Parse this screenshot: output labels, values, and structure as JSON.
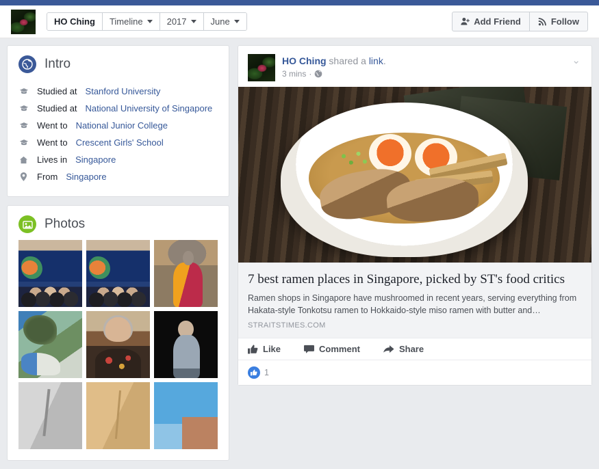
{
  "nav": {
    "profile_name": "HO Ching",
    "tabs": [
      {
        "label": "Timeline",
        "has_caret": true
      },
      {
        "label": "2017",
        "has_caret": true
      },
      {
        "label": "June",
        "has_caret": true
      }
    ],
    "add_friend_label": "Add Friend",
    "follow_label": "Follow",
    "avatar_icon": "profile-photo-thumbnail"
  },
  "intro": {
    "title": "Intro",
    "icon": "globe-icon",
    "rows": [
      {
        "icon": "graduation-cap-icon",
        "prefix": "Studied at",
        "link": "Stanford University"
      },
      {
        "icon": "graduation-cap-icon",
        "prefix": "Studied at",
        "link": "National University of Singapore"
      },
      {
        "icon": "graduation-cap-icon",
        "prefix": "Went to",
        "link": "National Junior College"
      },
      {
        "icon": "graduation-cap-icon",
        "prefix": "Went to",
        "link": "Crescent Girls' School"
      },
      {
        "icon": "home-icon",
        "prefix": "Lives in",
        "link": "Singapore"
      },
      {
        "icon": "map-pin-icon",
        "prefix": "From",
        "link": "Singapore"
      }
    ]
  },
  "photos": {
    "title": "Photos",
    "icon": "photo-icon",
    "items": [
      {
        "name": "photo-group-mural-1",
        "style": "ph-mural"
      },
      {
        "name": "photo-group-mural-2",
        "style": "ph-mural"
      },
      {
        "name": "photo-portrait-orange-jacket",
        "style": "ph-orange"
      },
      {
        "name": "photo-water-rocks",
        "style": "ph-water"
      },
      {
        "name": "photo-portrait-floral",
        "style": "ph-portrait"
      },
      {
        "name": "photo-woman-dark-background",
        "style": "ph-dark"
      },
      {
        "name": "photo-gray-texture",
        "style": "ph-gray"
      },
      {
        "name": "photo-sand-texture",
        "style": "ph-sand"
      },
      {
        "name": "photo-building-sky",
        "style": "ph-sky"
      }
    ]
  },
  "post": {
    "author": "HO Ching",
    "action_text": " shared a ",
    "link_word": "link",
    "trailing": ".",
    "timestamp": "3 mins",
    "separator": "·",
    "privacy_icon": "globe-icon",
    "menu_icon": "chevron-down-icon",
    "photo_icon": "ramen-bowl-photo",
    "link": {
      "title": "7 best ramen places in Singapore, picked by ST's food critics",
      "description": "Ramen shops in Singapore have mushroomed in recent years, serving everything from Hakata-style Tonkotsu ramen to Hokkaido-style miso ramen with butter and…",
      "domain": "STRAITSTIMES.COM"
    },
    "actions": [
      {
        "label": "Like",
        "icon": "thumbs-up-icon"
      },
      {
        "label": "Comment",
        "icon": "comment-icon"
      },
      {
        "label": "Share",
        "icon": "share-arrow-icon"
      }
    ],
    "like_count": "1",
    "like_badge_icon": "thumbs-up-badge-icon"
  },
  "colors": {
    "brand_blue": "#3b5998",
    "link_blue": "#365899",
    "like_blue": "#3b7fe0",
    "photo_green": "#7cc024",
    "page_bg": "#e9ebee"
  }
}
